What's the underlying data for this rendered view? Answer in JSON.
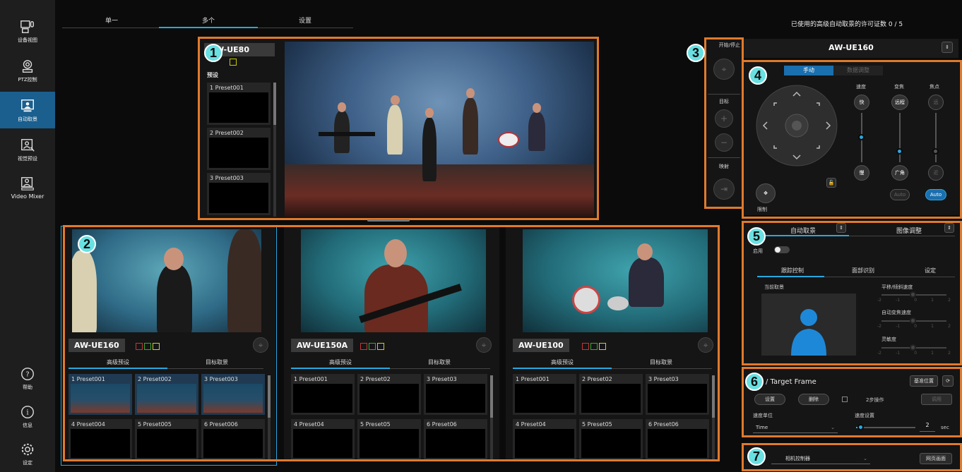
{
  "sidebar": {
    "items": [
      {
        "label": "设备视图",
        "icon": "device-view-icon"
      },
      {
        "label": "PTZ控制",
        "icon": "ptz-camera-icon"
      },
      {
        "label": "自动取景",
        "icon": "auto-framing-icon"
      },
      {
        "label": "视觉预设",
        "icon": "visual-preset-icon"
      },
      {
        "label": "Video Mixer",
        "icon": "video-mixer-icon"
      }
    ],
    "bottom": [
      {
        "label": "帮助",
        "icon": "help-icon"
      },
      {
        "label": "信息",
        "icon": "info-icon"
      },
      {
        "label": "设定",
        "icon": "settings-gear-icon"
      }
    ]
  },
  "tabs": [
    "单一",
    "多个",
    "设置"
  ],
  "license_text": "已使用的高级自动取景的许可证数  0 / 5",
  "badges": [
    "1",
    "2",
    "3",
    "4",
    "5",
    "6",
    "7"
  ],
  "main_camera": {
    "name": "AW-UE80",
    "preset_heading": "预设",
    "presets": [
      "1   Preset001",
      "2   Preset002",
      "3   Preset003"
    ]
  },
  "cameras": [
    {
      "name": "AW-UE160",
      "tabs": [
        "高级预设",
        "目标取景"
      ],
      "presets": [
        "1   Preset001",
        "2   Preset002",
        "3   Preset003",
        "4   Preset004",
        "5   Preset005",
        "6   Preset006"
      ]
    },
    {
      "name": "AW-UE150A",
      "tabs": [
        "高级预设",
        "目标取景"
      ],
      "presets": [
        "1   Preset001",
        "2   Preset02",
        "3   Preset03",
        "4   Preset04",
        "5   Preset05",
        "6   Preset06"
      ]
    },
    {
      "name": "AW-UE100",
      "tabs": [
        "高级预设",
        "目标取景"
      ],
      "presets": [
        "1   Preset001",
        "2   Preset02",
        "3   Preset03",
        "4   Preset04",
        "5   Preset05",
        "6   Preset06"
      ]
    }
  ],
  "side_controls": {
    "start_stop": "开始/停止",
    "target": "目标",
    "mapping": "映射"
  },
  "right": {
    "camera_select": "AW-UE160",
    "mode_tabs": [
      "手动",
      "数据调整"
    ],
    "speed_label": "速度",
    "fast": "快",
    "slow": "慢",
    "zoom_label": "变焦",
    "tele": "远程",
    "wide": "广角",
    "focus_label": "焦点",
    "focus_far": "远",
    "focus_near": "近",
    "auto": "Auto",
    "limit_label": "限制",
    "section5_tabs": [
      "自动取景",
      "图像调整"
    ],
    "enable_label": "启用",
    "sub_tabs": [
      "跟踪控制",
      "面部识别",
      "设定"
    ],
    "current_framing": "当前取景",
    "pan_tilt_speed": "平移/倾斜速度",
    "auto_zoom_speed": "自动变焦速度",
    "sensitivity": "灵敏度",
    "scale_ticks": [
      "-2",
      "-1",
      "0",
      "1",
      "2"
    ],
    "target_frame_title": "/ Target Frame",
    "base_position": "基准位置",
    "set_btn": "设置",
    "delete_btn": "删除",
    "two_step": "2步操作",
    "apply": "调用",
    "speed_unit_label": "速度单位",
    "speed_unit_value": "Time",
    "speed_setting_label": "速度设置",
    "speed_setting_value": "2",
    "sec": "sec",
    "camera_controller": "相机控制器",
    "web_screen": "网页画面"
  },
  "colors": {
    "accent": "#29a8e0",
    "highlight": "#e07a2c",
    "badge": "#69e0e2"
  }
}
